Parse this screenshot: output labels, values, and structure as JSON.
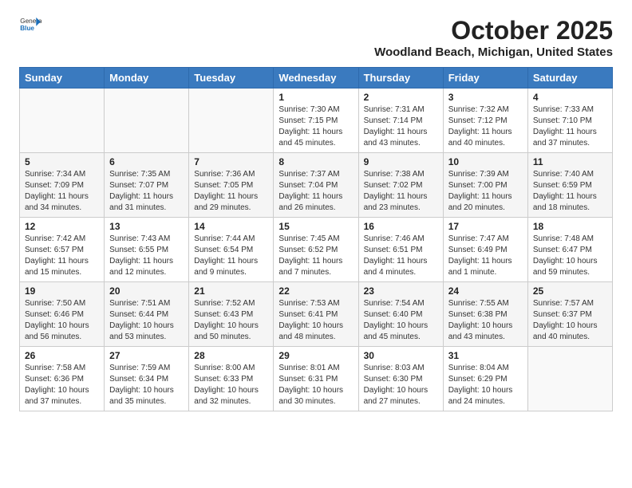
{
  "header": {
    "logo_general": "General",
    "logo_blue": "Blue",
    "month_year": "October 2025",
    "location": "Woodland Beach, Michigan, United States"
  },
  "days_of_week": [
    "Sunday",
    "Monday",
    "Tuesday",
    "Wednesday",
    "Thursday",
    "Friday",
    "Saturday"
  ],
  "weeks": [
    [
      {
        "day": "",
        "content": ""
      },
      {
        "day": "",
        "content": ""
      },
      {
        "day": "",
        "content": ""
      },
      {
        "day": "1",
        "content": "Sunrise: 7:30 AM\nSunset: 7:15 PM\nDaylight: 11 hours\nand 45 minutes."
      },
      {
        "day": "2",
        "content": "Sunrise: 7:31 AM\nSunset: 7:14 PM\nDaylight: 11 hours\nand 43 minutes."
      },
      {
        "day": "3",
        "content": "Sunrise: 7:32 AM\nSunset: 7:12 PM\nDaylight: 11 hours\nand 40 minutes."
      },
      {
        "day": "4",
        "content": "Sunrise: 7:33 AM\nSunset: 7:10 PM\nDaylight: 11 hours\nand 37 minutes."
      }
    ],
    [
      {
        "day": "5",
        "content": "Sunrise: 7:34 AM\nSunset: 7:09 PM\nDaylight: 11 hours\nand 34 minutes."
      },
      {
        "day": "6",
        "content": "Sunrise: 7:35 AM\nSunset: 7:07 PM\nDaylight: 11 hours\nand 31 minutes."
      },
      {
        "day": "7",
        "content": "Sunrise: 7:36 AM\nSunset: 7:05 PM\nDaylight: 11 hours\nand 29 minutes."
      },
      {
        "day": "8",
        "content": "Sunrise: 7:37 AM\nSunset: 7:04 PM\nDaylight: 11 hours\nand 26 minutes."
      },
      {
        "day": "9",
        "content": "Sunrise: 7:38 AM\nSunset: 7:02 PM\nDaylight: 11 hours\nand 23 minutes."
      },
      {
        "day": "10",
        "content": "Sunrise: 7:39 AM\nSunset: 7:00 PM\nDaylight: 11 hours\nand 20 minutes."
      },
      {
        "day": "11",
        "content": "Sunrise: 7:40 AM\nSunset: 6:59 PM\nDaylight: 11 hours\nand 18 minutes."
      }
    ],
    [
      {
        "day": "12",
        "content": "Sunrise: 7:42 AM\nSunset: 6:57 PM\nDaylight: 11 hours\nand 15 minutes."
      },
      {
        "day": "13",
        "content": "Sunrise: 7:43 AM\nSunset: 6:55 PM\nDaylight: 11 hours\nand 12 minutes."
      },
      {
        "day": "14",
        "content": "Sunrise: 7:44 AM\nSunset: 6:54 PM\nDaylight: 11 hours\nand 9 minutes."
      },
      {
        "day": "15",
        "content": "Sunrise: 7:45 AM\nSunset: 6:52 PM\nDaylight: 11 hours\nand 7 minutes."
      },
      {
        "day": "16",
        "content": "Sunrise: 7:46 AM\nSunset: 6:51 PM\nDaylight: 11 hours\nand 4 minutes."
      },
      {
        "day": "17",
        "content": "Sunrise: 7:47 AM\nSunset: 6:49 PM\nDaylight: 11 hours\nand 1 minute."
      },
      {
        "day": "18",
        "content": "Sunrise: 7:48 AM\nSunset: 6:47 PM\nDaylight: 10 hours\nand 59 minutes."
      }
    ],
    [
      {
        "day": "19",
        "content": "Sunrise: 7:50 AM\nSunset: 6:46 PM\nDaylight: 10 hours\nand 56 minutes."
      },
      {
        "day": "20",
        "content": "Sunrise: 7:51 AM\nSunset: 6:44 PM\nDaylight: 10 hours\nand 53 minutes."
      },
      {
        "day": "21",
        "content": "Sunrise: 7:52 AM\nSunset: 6:43 PM\nDaylight: 10 hours\nand 50 minutes."
      },
      {
        "day": "22",
        "content": "Sunrise: 7:53 AM\nSunset: 6:41 PM\nDaylight: 10 hours\nand 48 minutes."
      },
      {
        "day": "23",
        "content": "Sunrise: 7:54 AM\nSunset: 6:40 PM\nDaylight: 10 hours\nand 45 minutes."
      },
      {
        "day": "24",
        "content": "Sunrise: 7:55 AM\nSunset: 6:38 PM\nDaylight: 10 hours\nand 43 minutes."
      },
      {
        "day": "25",
        "content": "Sunrise: 7:57 AM\nSunset: 6:37 PM\nDaylight: 10 hours\nand 40 minutes."
      }
    ],
    [
      {
        "day": "26",
        "content": "Sunrise: 7:58 AM\nSunset: 6:36 PM\nDaylight: 10 hours\nand 37 minutes."
      },
      {
        "day": "27",
        "content": "Sunrise: 7:59 AM\nSunset: 6:34 PM\nDaylight: 10 hours\nand 35 minutes."
      },
      {
        "day": "28",
        "content": "Sunrise: 8:00 AM\nSunset: 6:33 PM\nDaylight: 10 hours\nand 32 minutes."
      },
      {
        "day": "29",
        "content": "Sunrise: 8:01 AM\nSunset: 6:31 PM\nDaylight: 10 hours\nand 30 minutes."
      },
      {
        "day": "30",
        "content": "Sunrise: 8:03 AM\nSunset: 6:30 PM\nDaylight: 10 hours\nand 27 minutes."
      },
      {
        "day": "31",
        "content": "Sunrise: 8:04 AM\nSunset: 6:29 PM\nDaylight: 10 hours\nand 24 minutes."
      },
      {
        "day": "",
        "content": ""
      }
    ]
  ]
}
